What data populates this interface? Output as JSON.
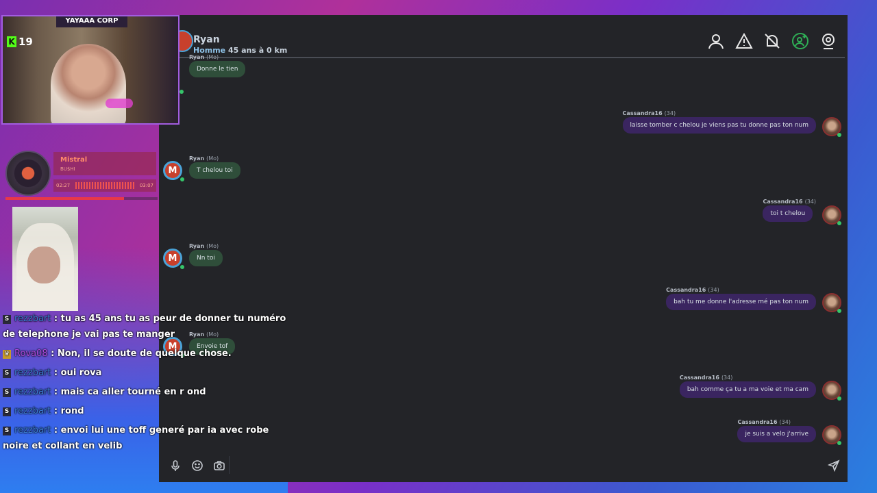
{
  "chat_app": {
    "contact": {
      "avatar_letter": "",
      "name": "Ryan",
      "gender": "Homme",
      "details": "45 ans à 0 km"
    },
    "header_icons": [
      "profile-icon",
      "report-icon",
      "block-icon",
      "add-friend-icon",
      "webcam-icon"
    ],
    "messages": [
      {
        "side": "left",
        "author": "Ryan",
        "tag": "(Mo)",
        "text": "Donne le tien",
        "avatar_letter": "M"
      },
      {
        "side": "right",
        "author": "Cassandra16",
        "tag": "(34)",
        "text": "laisse tomber c chelou je viens pas tu donne pas ton num"
      },
      {
        "side": "left",
        "author": "Ryan",
        "tag": "(Mo)",
        "text": "T chelou toi",
        "avatar_letter": "M"
      },
      {
        "side": "right",
        "author": "Cassandra16",
        "tag": "(34)",
        "text": "toi t chelou"
      },
      {
        "side": "left",
        "author": "Ryan",
        "tag": "(Mo)",
        "text": "Nn toi",
        "avatar_letter": "M"
      },
      {
        "side": "right",
        "author": "Cassandra16",
        "tag": "(34)",
        "text": "bah tu me donne l'adresse mé pas ton num"
      },
      {
        "side": "left",
        "author": "Ryan",
        "tag": "(Mo)",
        "text": "Envoie tof",
        "avatar_letter": "M"
      },
      {
        "side": "right",
        "author": "Cassandra16",
        "tag": "(34)",
        "text": "bah comme ça tu a ma voie et ma cam"
      },
      {
        "side": "right",
        "author": "Cassandra16",
        "tag": "(34)",
        "text": "je suis a velo j'arrive"
      }
    ],
    "composer_icons": [
      "microphone-icon",
      "emoji-icon",
      "camera-icon",
      "send-icon"
    ]
  },
  "stream": {
    "cam_title": "YAYAAA CORP",
    "kick_letter": "K",
    "viewer_count": "19",
    "music": {
      "title": "Mistral",
      "artist": "BU$HI",
      "elapsed": "02:27",
      "total": "03:07",
      "progress": 0.78
    }
  },
  "stream_chat": [
    {
      "badge": "S",
      "user": "rezzbart",
      "text": ": tu as 45 ans tu as peur de donner tu numéro de telephone je vai pas te manger"
    },
    {
      "badge": "♛",
      "user": "Rova08",
      "text": ": Non, il se doute de quelque chose."
    },
    {
      "badge": "S",
      "user": "rezzbart",
      "text": ": oui rova"
    },
    {
      "badge": "S",
      "user": "rezzbart",
      "text": ": mais ca aller tourné en r ond"
    },
    {
      "badge": "S",
      "user": "rezzbart",
      "text": ": rond"
    },
    {
      "badge": "S",
      "user": "rezzbart",
      "text": ": envoi lui une toff generé par ia avec robe noire et collant en velib"
    }
  ]
}
